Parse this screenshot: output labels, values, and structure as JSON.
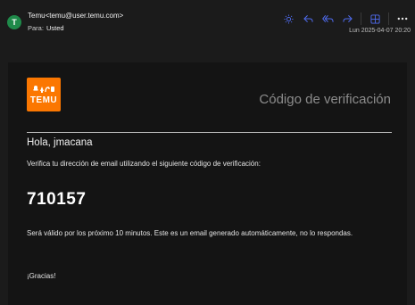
{
  "header": {
    "avatar_letter": "T",
    "sender": "Temu<temu@user.temu.com>",
    "to_label": "Para:",
    "to_name": "Usted",
    "date": "Lun 2025-04-07 20:20",
    "toolbar_icons": [
      "sun-icon",
      "reply-icon",
      "reply-all-icon",
      "forward-icon",
      "grid-icon",
      "more-icon"
    ],
    "accent_color": "#4f6bed"
  },
  "email": {
    "brand_color": "#fb7701",
    "logo_text": "TEMU",
    "title": "Código de verificación",
    "greeting": "Hola, jmacana",
    "instruction": "Verifica tu dirección de email utilizando el siguiente código de verificación:",
    "code": "710157",
    "validity": "Será válido por los próximo 10 minutos. Este es un email generado automáticamente, no lo respondas.",
    "thanks": "¡Gracias!"
  }
}
